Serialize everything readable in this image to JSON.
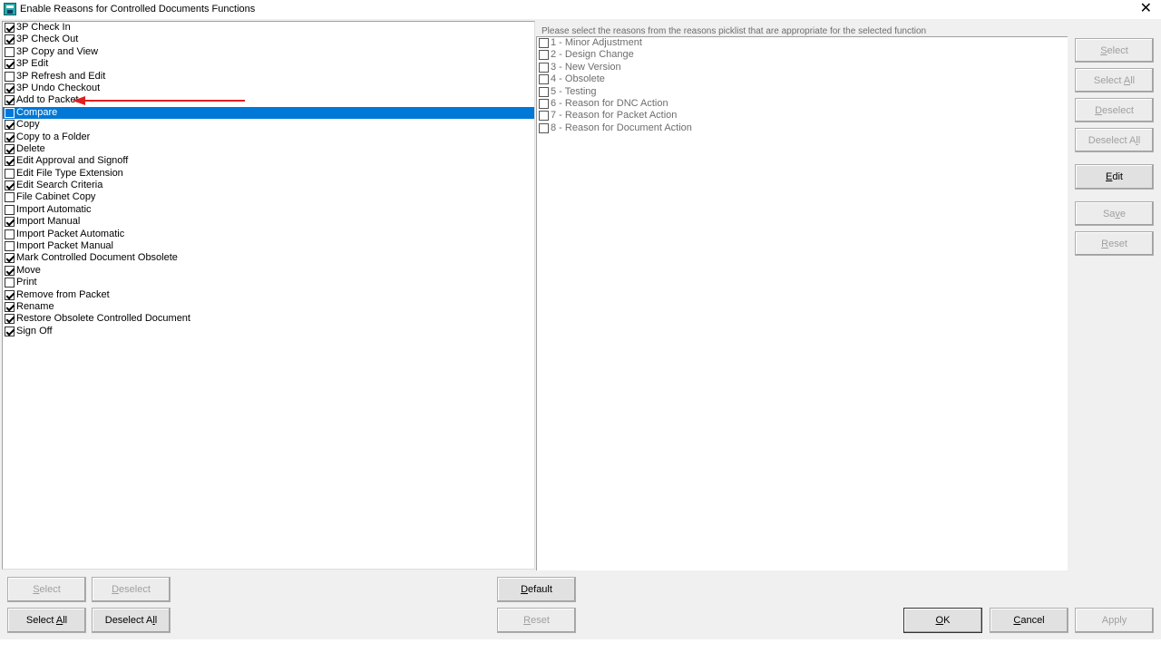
{
  "window": {
    "title": "Enable Reasons for Controlled Documents Functions",
    "close_glyph": "✕"
  },
  "functions_list": [
    {
      "label": "3P Check In",
      "checked": true,
      "selected": false
    },
    {
      "label": "3P Check Out",
      "checked": true,
      "selected": false
    },
    {
      "label": "3P Copy and View",
      "checked": false,
      "selected": false
    },
    {
      "label": "3P Edit",
      "checked": true,
      "selected": false
    },
    {
      "label": "3P Refresh and Edit",
      "checked": false,
      "selected": false
    },
    {
      "label": "3P Undo Checkout",
      "checked": true,
      "selected": false
    },
    {
      "label": "Add to Packet",
      "checked": true,
      "selected": false
    },
    {
      "label": "Compare",
      "checked": false,
      "selected": true
    },
    {
      "label": "Copy",
      "checked": true,
      "selected": false
    },
    {
      "label": "Copy to a Folder",
      "checked": true,
      "selected": false
    },
    {
      "label": "Delete",
      "checked": true,
      "selected": false
    },
    {
      "label": "Edit Approval and Signoff",
      "checked": true,
      "selected": false
    },
    {
      "label": "Edit File Type Extension",
      "checked": false,
      "selected": false
    },
    {
      "label": "Edit Search Criteria",
      "checked": true,
      "selected": false
    },
    {
      "label": "File Cabinet Copy",
      "checked": false,
      "selected": false
    },
    {
      "label": "Import Automatic",
      "checked": false,
      "selected": false
    },
    {
      "label": "Import Manual",
      "checked": true,
      "selected": false
    },
    {
      "label": "Import Packet Automatic",
      "checked": false,
      "selected": false
    },
    {
      "label": "Import Packet Manual",
      "checked": false,
      "selected": false
    },
    {
      "label": "Mark Controlled Document Obsolete",
      "checked": true,
      "selected": false
    },
    {
      "label": "Move",
      "checked": true,
      "selected": false
    },
    {
      "label": "Print",
      "checked": false,
      "selected": false
    },
    {
      "label": "Remove from Packet",
      "checked": true,
      "selected": false
    },
    {
      "label": "Rename",
      "checked": true,
      "selected": false
    },
    {
      "label": "Restore Obsolete Controlled Document",
      "checked": true,
      "selected": false
    },
    {
      "label": "Sign Off",
      "checked": true,
      "selected": false
    }
  ],
  "reasons": {
    "caption": "Please select the reasons from the reasons picklist that are appropriate for the selected function",
    "items": [
      {
        "label": "1 - Minor Adjustment",
        "checked": false
      },
      {
        "label": "2 - Design Change",
        "checked": false
      },
      {
        "label": "3 - New Version",
        "checked": false
      },
      {
        "label": "4 - Obsolete",
        "checked": false
      },
      {
        "label": "5 - Testing",
        "checked": false
      },
      {
        "label": "6 - Reason for DNC Action",
        "checked": false
      },
      {
        "label": "7 - Reason for Packet Action",
        "checked": false
      },
      {
        "label": "8 - Reason for Document Action",
        "checked": false
      }
    ]
  },
  "right_buttons": {
    "select": {
      "pre": "",
      "key": "S",
      "post": "elect",
      "enabled": false
    },
    "select_all": {
      "pre": "Select ",
      "key": "A",
      "post": "ll",
      "enabled": false
    },
    "deselect": {
      "pre": "",
      "key": "D",
      "post": "eselect",
      "enabled": false
    },
    "deselect_all": {
      "pre": "Deselect A",
      "key": "l",
      "post": "l",
      "enabled": false
    },
    "edit": {
      "pre": "",
      "key": "E",
      "post": "dit",
      "enabled": true
    },
    "save": {
      "pre": "Sa",
      "key": "v",
      "post": "e",
      "enabled": false
    },
    "reset": {
      "pre": "",
      "key": "R",
      "post": "eset",
      "enabled": false
    }
  },
  "bottom_left_buttons": {
    "select": {
      "pre": "",
      "key": "S",
      "post": "elect",
      "enabled": false
    },
    "deselect": {
      "pre": "",
      "key": "D",
      "post": "eselect",
      "enabled": false
    },
    "select_all": {
      "pre": "Select ",
      "key": "A",
      "post": "ll",
      "enabled": true
    },
    "deselect_all": {
      "pre": "Deselect A",
      "key": "l",
      "post": "l",
      "enabled": true
    }
  },
  "bottom_center_buttons": {
    "default": {
      "pre": "",
      "key": "D",
      "post": "efault",
      "enabled": true
    },
    "reset": {
      "pre": "",
      "key": "R",
      "post": "eset",
      "enabled": false
    }
  },
  "dialog_buttons": {
    "ok": {
      "pre": "",
      "key": "O",
      "post": "K",
      "enabled": true
    },
    "cancel": {
      "pre": "",
      "key": "C",
      "post": "ancel",
      "enabled": true
    },
    "apply": {
      "pre": "Apply",
      "key": "",
      "post": "",
      "enabled": false
    }
  },
  "annotation": {
    "arrow_color": "#e02020"
  }
}
